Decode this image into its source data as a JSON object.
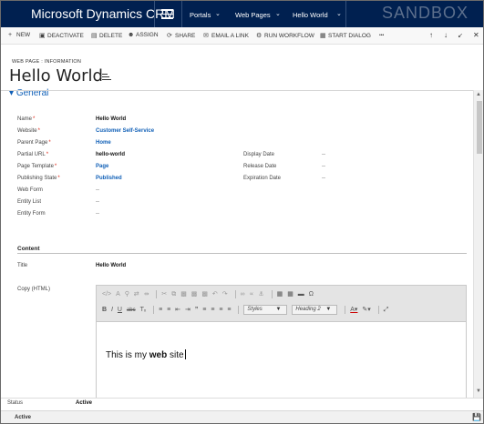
{
  "nav": {
    "brand": "Microsoft Dynamics CRM",
    "items": [
      "Portals",
      "Web Pages",
      "Hello World"
    ],
    "environment": "SANDBOX"
  },
  "commands": [
    {
      "icon": "plus-icon",
      "label": "NEW"
    },
    {
      "icon": "deactivate-icon",
      "label": "DEACTIVATE"
    },
    {
      "icon": "trash-icon",
      "label": "DELETE"
    },
    {
      "icon": "assign-icon",
      "label": "ASSIGN"
    },
    {
      "icon": "share-icon",
      "label": "SHARE"
    },
    {
      "icon": "email-icon",
      "label": "EMAIL A LINK"
    },
    {
      "icon": "workflow-icon",
      "label": "RUN WORKFLOW"
    },
    {
      "icon": "dialog-icon",
      "label": "START DIALOG"
    },
    {
      "icon": "more-icon",
      "label": "•••"
    }
  ],
  "header": {
    "breadcrumb": "WEB PAGE : INFORMATION",
    "title": "Hello World"
  },
  "section": {
    "general": "General"
  },
  "fields": {
    "name": {
      "label": "Name",
      "value": "Hello World"
    },
    "website": {
      "label": "Website",
      "value": "Customer Self-Service"
    },
    "parent_page": {
      "label": "Parent Page",
      "value": "Home"
    },
    "partial_url": {
      "label": "Partial URL",
      "value": "hello-world"
    },
    "page_template": {
      "label": "Page Template",
      "value": "Page"
    },
    "publishing_state": {
      "label": "Publishing State",
      "value": "Published"
    },
    "web_form": {
      "label": "Web Form",
      "value": "--"
    },
    "entity_list": {
      "label": "Entity List",
      "value": "--"
    },
    "entity_form": {
      "label": "Entity Form",
      "value": "--"
    },
    "display_date": {
      "label": "Display Date",
      "value": "--"
    },
    "release_date": {
      "label": "Release Date",
      "value": "--"
    },
    "expiration_date": {
      "label": "Expiration Date",
      "value": "--"
    }
  },
  "content": {
    "header": "Content",
    "title_label": "Title",
    "title_value": "Hello World",
    "copy_label": "Copy (HTML)",
    "editor": {
      "styles_dropdown": "Styles",
      "format_dropdown": "Heading 2",
      "text_before": "This is my ",
      "text_bold": "web",
      "text_after": " site"
    }
  },
  "footer": {
    "status_label": "Status",
    "status_value": "Active",
    "bottom_status": "Active"
  }
}
